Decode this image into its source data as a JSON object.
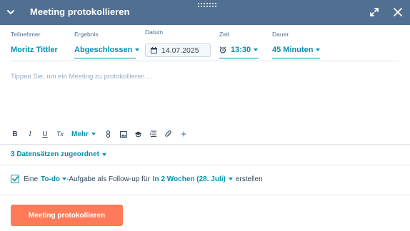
{
  "header": {
    "title": "Meeting protokollieren"
  },
  "fields": {
    "attendee": {
      "label": "Teilnehmer",
      "value": "Moritz Tittler"
    },
    "outcome": {
      "label": "Ergebnis",
      "value": "Abgeschlossen"
    },
    "date": {
      "label": "Datum",
      "value": "14.07.2025"
    },
    "time": {
      "label": "Zeit",
      "value": "13:30"
    },
    "duration": {
      "label": "Dauer",
      "value": "45 Minuten"
    }
  },
  "editor": {
    "placeholder": "Tippen Sie, um ein Meeting zu protokollieren ..."
  },
  "toolbar": {
    "bold": "B",
    "italic": "I",
    "underline": "U",
    "clear_format": "Tx",
    "more": "Mehr"
  },
  "associations": {
    "label": "3 Datensätzen zugeordnet"
  },
  "followup": {
    "checked": true,
    "text_before": "Eine",
    "task_type": "To-do",
    "text_middle": "-Aufgabe als Follow-up für",
    "due": "In 2 Wochen (28. Juli)",
    "text_after": "erstellen"
  },
  "actions": {
    "submit_label": "Meeting protokollieren"
  },
  "colors": {
    "header_bg": "#516f90",
    "link": "#0091ae",
    "primary_button": "#ff7a59"
  }
}
